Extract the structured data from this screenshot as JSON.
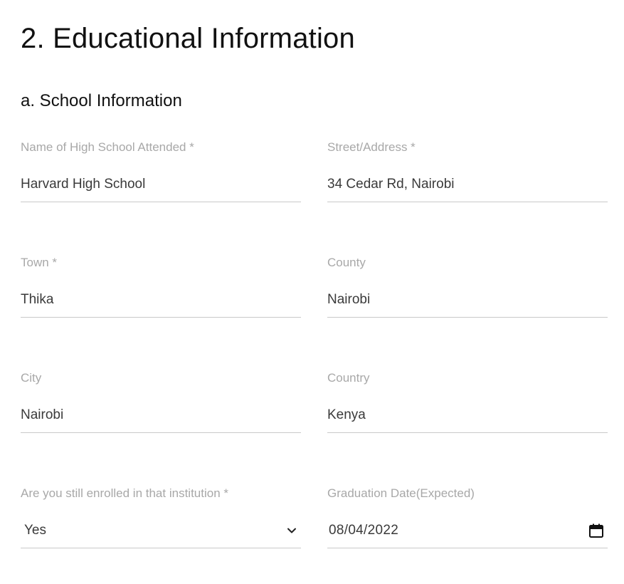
{
  "section": {
    "title": "2. Educational Information"
  },
  "subsection": {
    "title": "a. School Information"
  },
  "fields": {
    "high_school": {
      "label": "Name of High School Attended *",
      "value": "Harvard High School"
    },
    "street": {
      "label": "Street/Address *",
      "value": "34 Cedar Rd, Nairobi"
    },
    "town": {
      "label": "Town *",
      "value": "Thika"
    },
    "county": {
      "label": "County",
      "value": "Nairobi"
    },
    "city": {
      "label": "City",
      "value": "Nairobi"
    },
    "country": {
      "label": "Country",
      "value": "Kenya"
    },
    "enrolled": {
      "label": "Are you still enrolled in that institution *",
      "value": "Yes"
    },
    "graduation": {
      "label": "Graduation Date(Expected)",
      "value": "08/04/2022"
    }
  },
  "icons": {
    "select_arrow": "chevron-down-icon",
    "date_picker": "calendar-icon"
  },
  "colors": {
    "label": "#a8a8a8",
    "value": "#3a3a3a",
    "underline": "#c9c9c9"
  }
}
